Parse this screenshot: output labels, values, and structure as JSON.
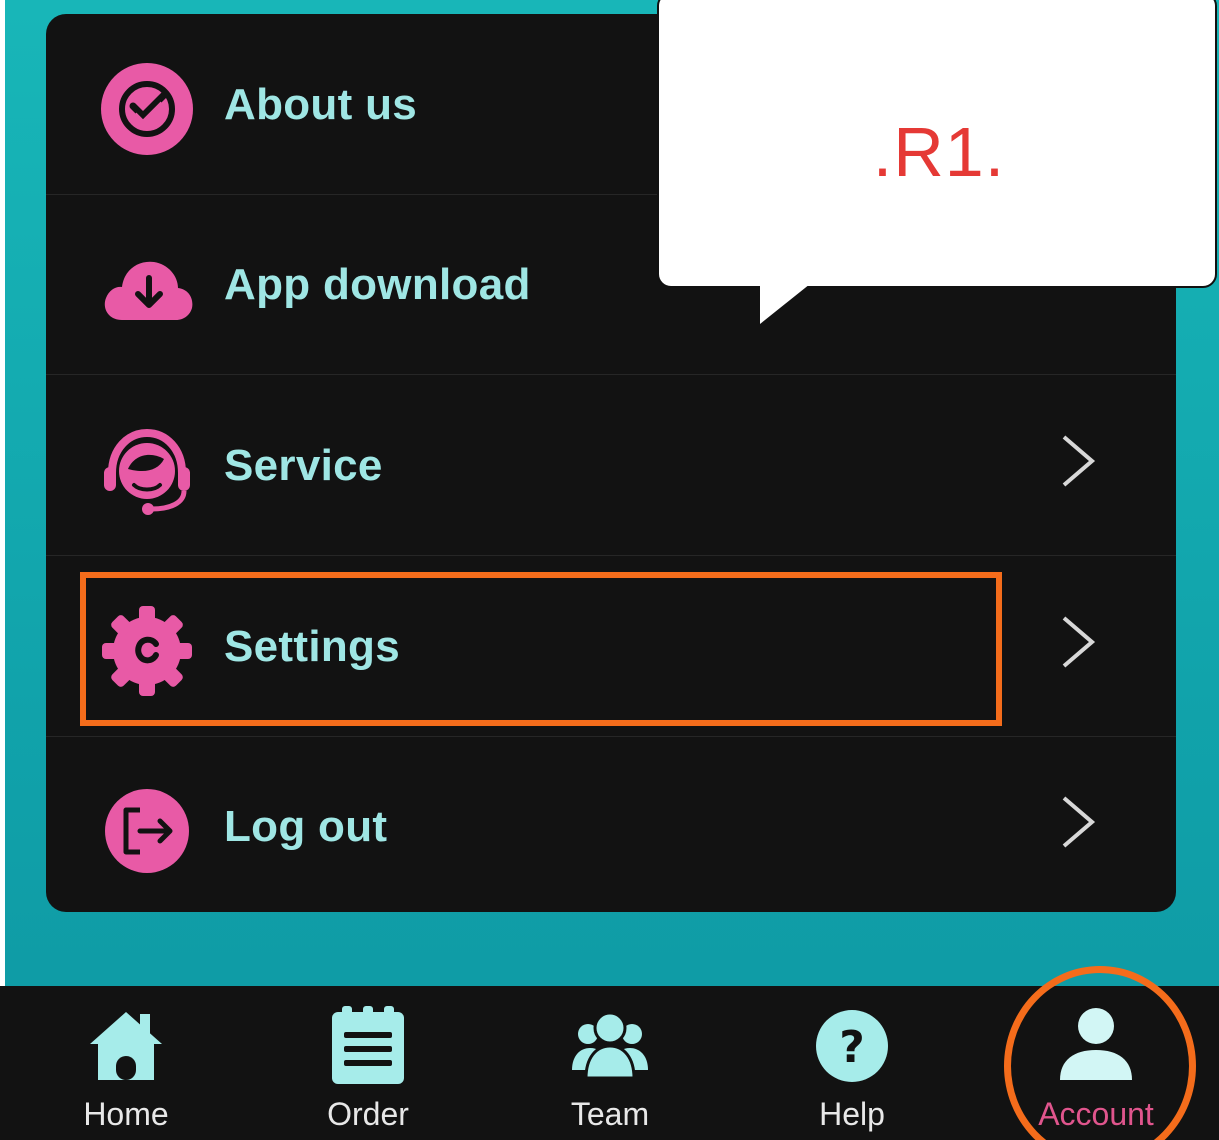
{
  "menu": {
    "items": [
      {
        "label": "About us",
        "icon": "about-check-icon"
      },
      {
        "label": "App download",
        "icon": "cloud-download-icon"
      },
      {
        "label": "Service",
        "icon": "customer-service-icon"
      },
      {
        "label": "Settings",
        "icon": "settings-gear-icon"
      },
      {
        "label": "Log out",
        "icon": "logout-icon"
      }
    ]
  },
  "callout": {
    "text": ".R1."
  },
  "nav": {
    "items": [
      {
        "label": "Home",
        "icon": "home-icon"
      },
      {
        "label": "Order",
        "icon": "order-clipboard-icon"
      },
      {
        "label": "Team",
        "icon": "team-icon"
      },
      {
        "label": "Help",
        "icon": "help-icon"
      },
      {
        "label": "Account",
        "icon": "account-icon",
        "active": true
      }
    ]
  },
  "colors": {
    "accent_pink": "#e85aa6",
    "label_teal": "#9fe6e4",
    "background_teal": "#11a3ab",
    "highlight_orange": "#f46c1b",
    "callout_red": "#e53935",
    "panel_dark": "#121212"
  }
}
